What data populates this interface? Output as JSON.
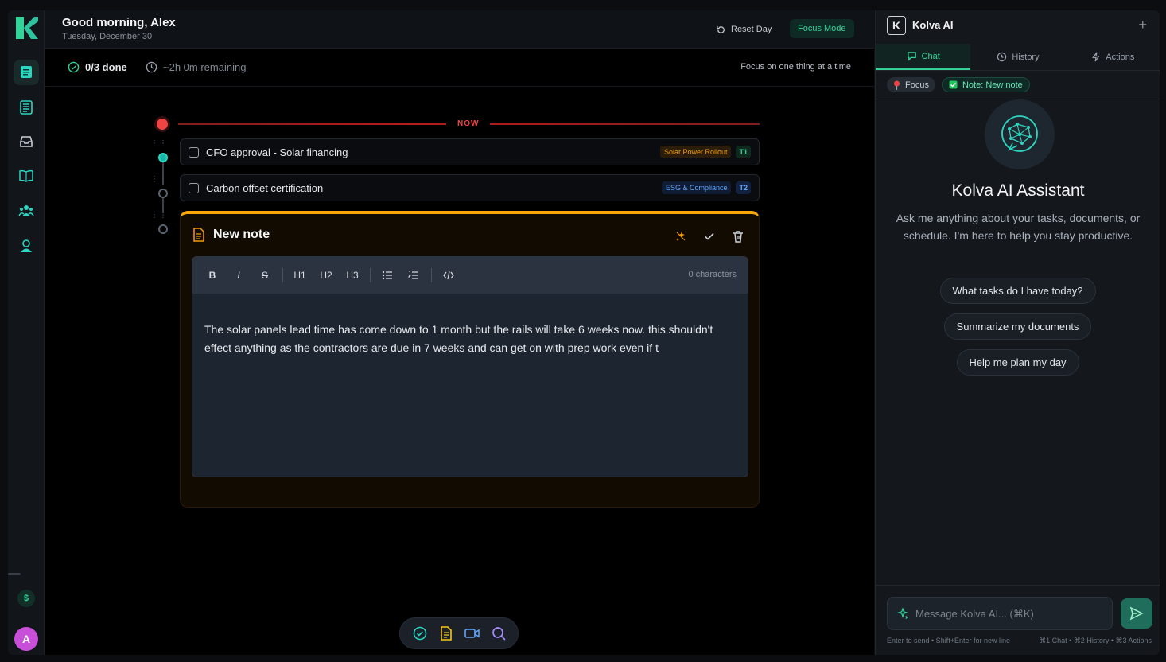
{
  "header": {
    "greeting": "Good morning, Alex",
    "date": "Tuesday, December 30",
    "reset_label": "Reset Day",
    "focus_mode_label": "Focus Mode"
  },
  "status": {
    "done": "0/3 done",
    "remaining": "~2h 0m remaining",
    "hint": "Focus on one thing at a time"
  },
  "timeline": {
    "now_label": "NOW"
  },
  "tasks": [
    {
      "title": "CFO approval - Solar financing",
      "tag": "Solar Power Rollout",
      "tier": "T1"
    },
    {
      "title": "Carbon offset certification",
      "tag": "ESG & Compliance",
      "tier": "T2"
    }
  ],
  "note": {
    "title": "New note",
    "toolbar": {
      "bold": "B",
      "italic": "I",
      "strike": "S",
      "h1": "H1",
      "h2": "H2",
      "h3": "H3"
    },
    "char_count": "0 characters",
    "body": "The solar panels lead time has come down to 1 month but the rails will take 6 weeks now. this shouldn't effect anything as the contractors are due in 7 weeks and can get on with prep work even if t"
  },
  "rail": {
    "avatar_initial": "A",
    "dollar": "$"
  },
  "panel": {
    "title": "Kolva AI",
    "logo_letter": "K",
    "tabs": [
      "Chat",
      "History",
      "Actions"
    ],
    "context_chips": [
      "Focus",
      "Note: New note"
    ],
    "assistant_title": "Kolva AI Assistant",
    "assistant_desc": "Ask me anything about your tasks, documents, or schedule. I'm here to help you stay productive.",
    "suggestions": [
      "What tasks do I have today?",
      "Summarize my documents",
      "Help me plan my day"
    ],
    "input_placeholder": "Message Kolva AI... (⌘K)",
    "hint_left": "Enter to send • Shift+Enter for new line",
    "hint_right": "⌘1 Chat • ⌘2 History • ⌘3 Actions"
  },
  "colors": {
    "accent": "#34d399",
    "now": "#ef4444",
    "note_accent": "#f5a70b"
  },
  "icons": [
    "logo-icon",
    "dashboard-icon",
    "documents-icon",
    "inbox-icon",
    "reading-icon",
    "team-icon",
    "profile-icon",
    "dollar-icon",
    "reset-icon",
    "check-circle-icon",
    "clock-icon",
    "note-icon",
    "ai-sparkle-icon",
    "check-icon",
    "trash-icon",
    "bullet-list-icon",
    "ordered-list-icon",
    "code-icon",
    "tasks-icon",
    "video-icon",
    "search-icon",
    "chat-icon",
    "history-icon",
    "bolt-icon",
    "pin-icon",
    "send-icon"
  ]
}
